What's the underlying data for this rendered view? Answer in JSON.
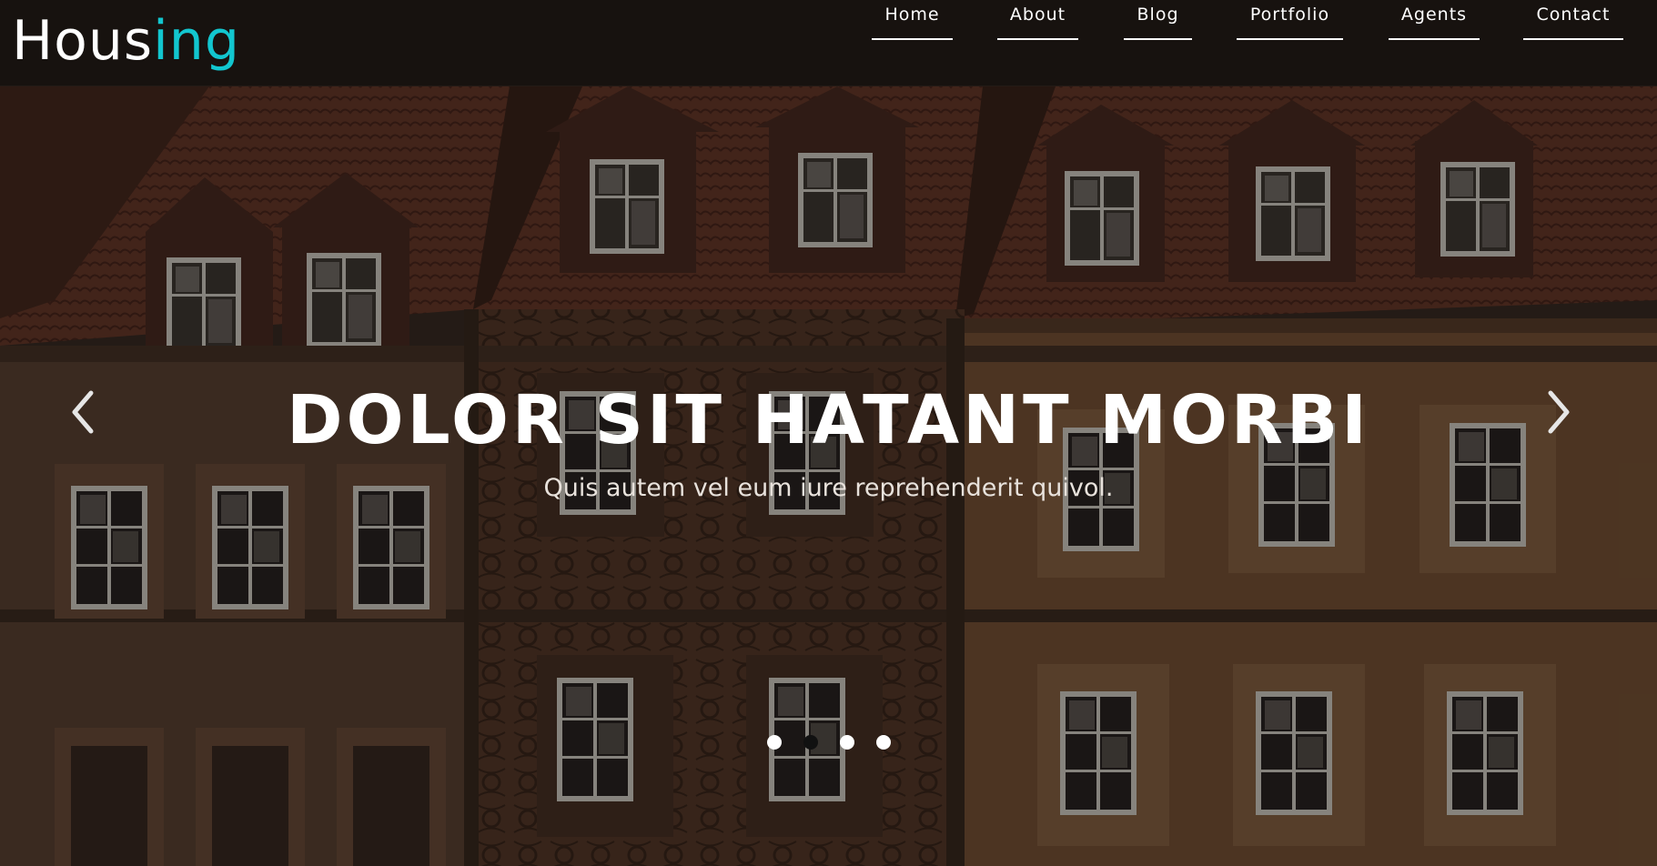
{
  "brand": {
    "name_part1": "Hous",
    "name_part2": "ing",
    "accent_color": "#12c6cf"
  },
  "nav": {
    "items": [
      {
        "label": "Home"
      },
      {
        "label": "About"
      },
      {
        "label": "Blog"
      },
      {
        "label": "Portfolio"
      },
      {
        "label": "Agents"
      },
      {
        "label": "Contact"
      }
    ]
  },
  "slide": {
    "title": "DOLOR SIT HATANT MORBI",
    "subtitle": "Quis autem vel eum iure reprehenderit quivol.",
    "background": "photo of old town building facade with dormer windows and tiled roofs",
    "active_slide": 2,
    "slide_count": 4
  },
  "controls": {
    "prev_icon": "chevron-left-icon",
    "next_icon": "chevron-right-icon"
  }
}
